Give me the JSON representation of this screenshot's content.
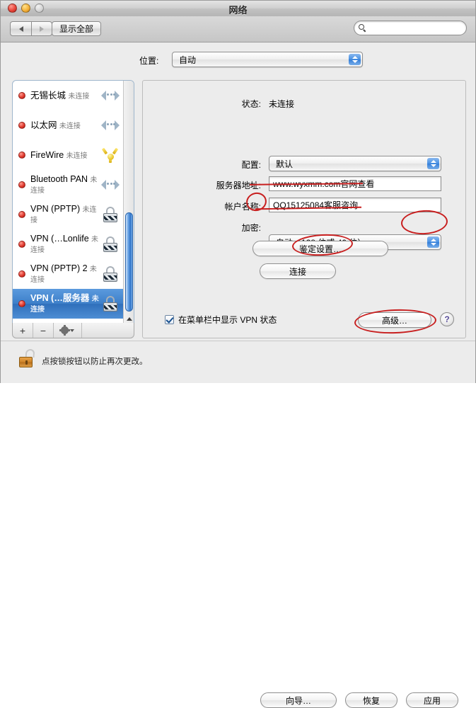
{
  "window": {
    "title": "网络",
    "traffic_lights": [
      "close",
      "minimize",
      "zoom"
    ]
  },
  "toolbar": {
    "back_icon": "chevron-left-icon",
    "forward_icon": "chevron-right-icon",
    "show_all_label": "显示全部",
    "search_placeholder": "",
    "search_value": "",
    "search_icon": "search-icon"
  },
  "location": {
    "label": "位置:",
    "value": "自动"
  },
  "services": [
    {
      "name": "无锡长城",
      "status": "未连接",
      "icon": "ethernet-icon",
      "selected": false
    },
    {
      "name": "以太网",
      "status": "未连接",
      "icon": "ethernet-icon",
      "selected": false
    },
    {
      "name": "FireWire",
      "status": "未连接",
      "icon": "firewire-icon",
      "selected": false
    },
    {
      "name": "Bluetooth PAN",
      "status": "未连接",
      "icon": "ethernet-icon",
      "selected": false
    },
    {
      "name": "VPN (PPTP)",
      "status": "未连接",
      "icon": "lock-icon",
      "selected": false
    },
    {
      "name": "VPN (…Lonlife",
      "status": "未连接",
      "icon": "lock-icon",
      "selected": false
    },
    {
      "name": "VPN (PPTP) 2",
      "status": "未连接",
      "icon": "lock-icon",
      "selected": false
    },
    {
      "name": "VPN (…服务器",
      "status": "未连接",
      "icon": "lock-icon",
      "selected": true
    }
  ],
  "list_footer": {
    "add_label": "+",
    "remove_label": "−",
    "action_icon": "gear-icon"
  },
  "detail": {
    "status_label": "状态:",
    "status_value": "未连接",
    "config_label": "配置:",
    "config_value": "默认",
    "server_label": "服务器地址:",
    "server_value": "www.wyxmm.com官网查看",
    "account_label": "帐户名称:",
    "account_value": "QQ15125084客服咨询",
    "encryption_label": "加密:",
    "encryption_value": "自动（128 位或 40 位）",
    "auth_settings_label": "鉴定设置…",
    "connect_label": "连接",
    "show_status_checkbox_label": "在菜单栏中显示 VPN 状态",
    "show_status_checked": true,
    "advanced_label": "高级…",
    "help_label": "?"
  },
  "bottom": {
    "lock_icon": "unlocked-padlock-icon",
    "lock_text": "点按锁按钮以防止再次更改。",
    "assistant_label": "向导…",
    "revert_label": "恢复",
    "apply_label": "应用"
  },
  "annotations": {
    "color": "#c81f1f",
    "marks": [
      "server-address-underline",
      "account-name-ellipse",
      "encryption-arrows-ellipse",
      "auth-settings-ellipse",
      "advanced-button-ellipse"
    ]
  }
}
